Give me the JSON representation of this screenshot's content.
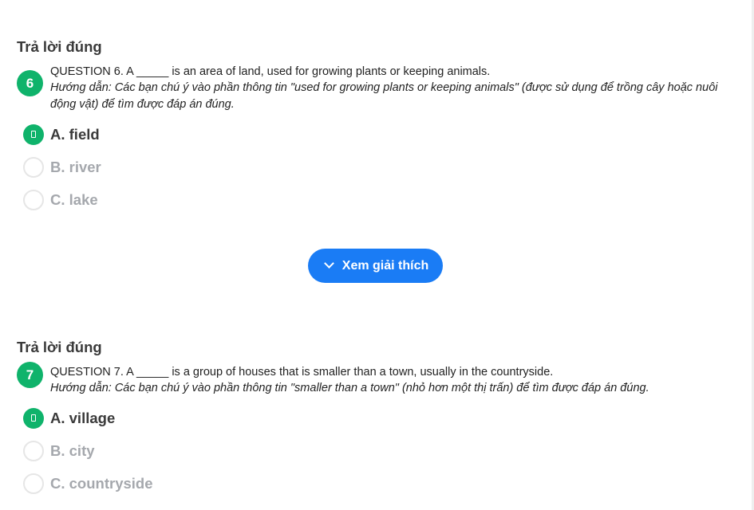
{
  "colors": {
    "correct_green": "#0fb36b",
    "button_blue": "#1a7cf5",
    "muted_option": "#a5a8ad"
  },
  "questions": [
    {
      "result_title": "Trả lời đúng",
      "number": "6",
      "text": "QUESTION 6. A _____ is an area of land, used for growing plants or keeping animals.",
      "hint": "Hướng dẫn: Các bạn chú ý vào phần thông tin \"used for growing plants or keeping animals\" (được sử dụng để trồng cây hoặc nuôi động vật) để tìm được đáp án đúng.",
      "options": [
        {
          "label": "A. field",
          "selected": true,
          "icon": "check-icon"
        },
        {
          "label": "B. river",
          "selected": false
        },
        {
          "label": "C. lake",
          "selected": false
        }
      ]
    },
    {
      "result_title": "Trả lời đúng",
      "number": "7",
      "text": "QUESTION 7. A _____ is a group of houses that is smaller than a town, usually in the countryside.",
      "hint": "Hướng dẫn: Các bạn chú ý vào phần thông tin \"smaller than a town\" (nhỏ hơn một thị trấn) để tìm được đáp án đúng.",
      "options": [
        {
          "label": "A. village",
          "selected": true,
          "icon": "check-icon"
        },
        {
          "label": "B. city",
          "selected": false
        },
        {
          "label": "C. countryside",
          "selected": false
        }
      ]
    }
  ],
  "explain_button": {
    "label": "Xem giải thích",
    "icon": "chevron-down-icon"
  }
}
